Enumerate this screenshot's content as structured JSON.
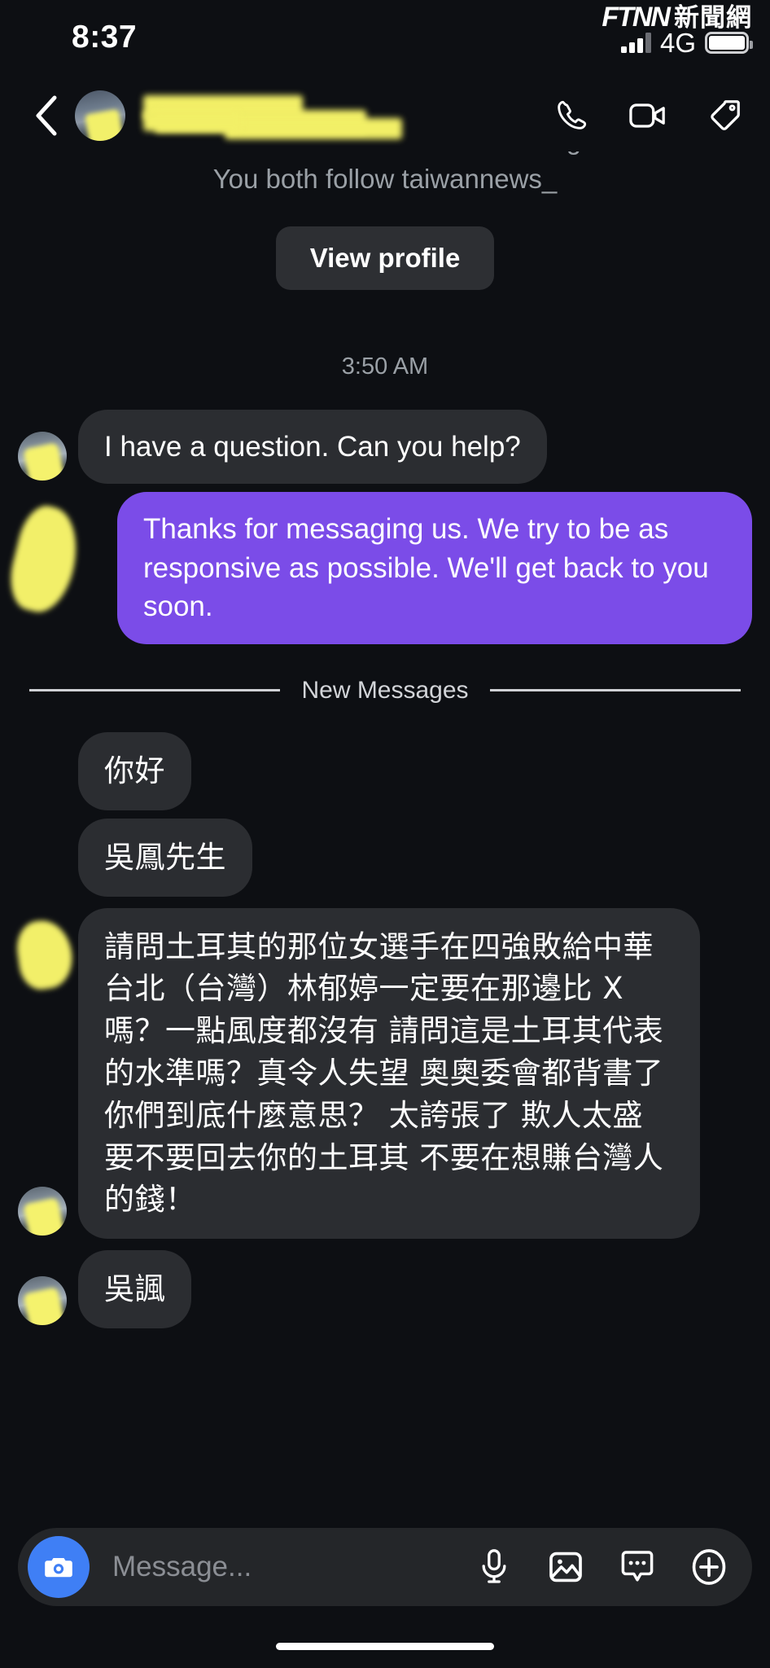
{
  "status_bar": {
    "time": "8:37",
    "network": "4G",
    "watermark_mark": "FTNN",
    "watermark_cn": "新聞網"
  },
  "header": {
    "contact_name_redacted": "",
    "actions": [
      "phone-icon",
      "video-icon",
      "tag-icon"
    ]
  },
  "profile_intro": {
    "line1": "You don't follow each other on Instagram",
    "line2": "You both follow taiwannews_",
    "view_profile_label": "View profile"
  },
  "thread": {
    "daystamp": "3:50 AM",
    "new_messages_label": "New Messages",
    "messages": [
      {
        "side": "in",
        "text": "I have a question. Can you help?"
      },
      {
        "side": "out",
        "text": "Thanks for messaging us. We try to be as responsive as possible. We'll get back to you soon."
      },
      {
        "side": "in",
        "text": "你好"
      },
      {
        "side": "in",
        "text": "吳鳳先生"
      },
      {
        "side": "in",
        "text": "請問土耳其的那位女選手在四強敗給中華台北（台灣）林郁婷一定要在那邊比 X 嗎？一點風度都沒有 請問這是土耳其代表的水準嗎？真令人失望 奧奧委會都背書了 你們到底什麼意思？ 太誇張了 欺人太盛 要不要回去你的土耳其 不要在想賺台灣人的錢！"
      },
      {
        "side": "in",
        "text": "吳諷"
      }
    ]
  },
  "composer": {
    "placeholder": "Message...",
    "icons": [
      "camera-icon",
      "microphone-icon",
      "image-icon",
      "sticker-icon",
      "plus-icon"
    ]
  },
  "colors": {
    "background": "#0d0f13",
    "incoming_bubble": "#2b2d31",
    "outgoing_bubble": "#7b4ce8",
    "camera_button": "#3f7ff5",
    "redaction": "#f2ef69",
    "muted_text": "#9aa0a6"
  }
}
